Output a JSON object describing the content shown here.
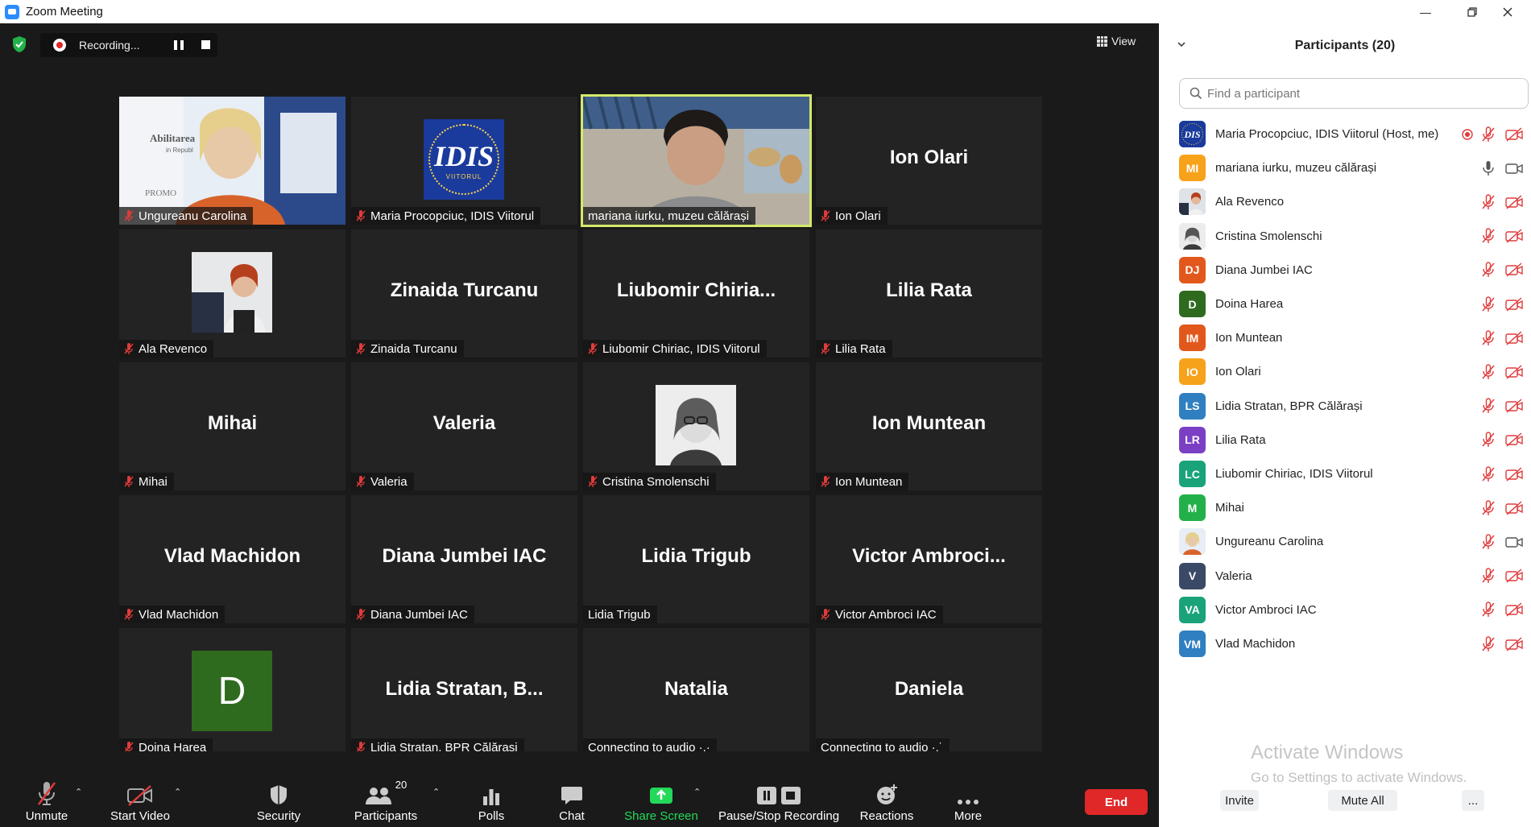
{
  "window": {
    "title": "Zoom Meeting",
    "icon": "zoom-camera-icon"
  },
  "meeting": {
    "recording_label": "Recording...",
    "view_label": "View"
  },
  "tiles": [
    {
      "display": "photo",
      "label": "Ungureanu Carolina",
      "muted": true,
      "photo_text_1": "Abilitarea",
      "photo_text_2": "in Republ",
      "photo_text_3": "PROMO"
    },
    {
      "display": "logo",
      "label": "Maria Procopciuc, IDIS Viitorul",
      "muted": true,
      "logo_text": "IDIS",
      "logo_sub": "VIITORUL"
    },
    {
      "display": "photo",
      "label": "mariana iurku, muzeu călărași",
      "muted": false,
      "active": true
    },
    {
      "display": "name",
      "big": "Ion Olari",
      "label": "Ion Olari",
      "muted": true
    },
    {
      "display": "photo-small",
      "label": "Ala Revenco",
      "muted": true
    },
    {
      "display": "name",
      "big": "Zinaida Turcanu",
      "label": "Zinaida Turcanu",
      "muted": true
    },
    {
      "display": "name",
      "big": "Liubomir  Chiria...",
      "label": "Liubomir Chiriac, IDIS Viitorul",
      "muted": true
    },
    {
      "display": "name",
      "big": "Lilia Rata",
      "label": "Lilia Rata",
      "muted": true
    },
    {
      "display": "name",
      "big": "Mihai",
      "label": "Mihai",
      "muted": true
    },
    {
      "display": "name",
      "big": "Valeria",
      "label": "Valeria",
      "muted": true
    },
    {
      "display": "photo-small-gray",
      "label": "Cristina Smolenschi",
      "muted": true
    },
    {
      "display": "name",
      "big": "Ion Muntean",
      "label": "Ion Muntean",
      "muted": true
    },
    {
      "display": "name",
      "big": "Vlad Machidon",
      "label": "Vlad Machidon",
      "muted": true
    },
    {
      "display": "name",
      "big": "Diana Jumbei IAC",
      "label": "Diana Jumbei IAC",
      "muted": true
    },
    {
      "display": "name",
      "big": "Lidia Trigub",
      "label": "Lidia Trigub",
      "muted": false
    },
    {
      "display": "name",
      "big": "Victor  Ambroci...",
      "label": "Victor Ambroci IAC",
      "muted": true
    },
    {
      "display": "letter",
      "letter": "D",
      "label": "Doina Harea",
      "muted": true
    },
    {
      "display": "name",
      "big": "Lidia  Stratan,  B...",
      "label": "Lidia Stratan, BPR Călărași",
      "muted": true
    },
    {
      "display": "name",
      "big": "Natalia",
      "label": "Connecting to audio ·.·",
      "muted": false
    },
    {
      "display": "name",
      "big": "Daniela",
      "label": "Connecting to audio ·.˙",
      "muted": false
    }
  ],
  "toolbar": {
    "unmute": "Unmute",
    "start_video": "Start Video",
    "security": "Security",
    "participants": "Participants",
    "participants_count": "20",
    "polls": "Polls",
    "chat": "Chat",
    "share_screen": "Share Screen",
    "pause_stop_recording": "Pause/Stop Recording",
    "reactions": "Reactions",
    "more": "More",
    "end": "End",
    "share_color": "#23d959",
    "end_color": "#e02828"
  },
  "panel": {
    "title": "Participants (20)",
    "search_placeholder": "Find a participant",
    "participants": [
      {
        "name": "Maria Procopciuc, IDIS Viitorul (Host, me)",
        "initials": "",
        "avatar": "logo",
        "color": "#1a3a9c",
        "recording": true,
        "mic": "muted",
        "cam": "off"
      },
      {
        "name": "mariana iurku, muzeu călărași",
        "initials": "MI",
        "avatar": "initials",
        "color": "#f7a21b",
        "recording": false,
        "mic": "on",
        "cam": "on"
      },
      {
        "name": "Ala Revenco",
        "initials": "",
        "avatar": "photo",
        "color": "#5a6b7a",
        "recording": false,
        "mic": "muted",
        "cam": "off"
      },
      {
        "name": "Cristina Smolenschi",
        "initials": "",
        "avatar": "photo-gray",
        "color": "#9a9a9a",
        "recording": false,
        "mic": "muted",
        "cam": "off"
      },
      {
        "name": "Diana Jumbei IAC",
        "initials": "DJ",
        "avatar": "initials",
        "color": "#e2581c",
        "recording": false,
        "mic": "muted",
        "cam": "off"
      },
      {
        "name": "Doina Harea",
        "initials": "D",
        "avatar": "initials",
        "color": "#2e6b1f",
        "recording": false,
        "mic": "muted",
        "cam": "off"
      },
      {
        "name": "Ion Muntean",
        "initials": "IM",
        "avatar": "initials",
        "color": "#e2581c",
        "recording": false,
        "mic": "muted",
        "cam": "off"
      },
      {
        "name": "Ion Olari",
        "initials": "IO",
        "avatar": "initials",
        "color": "#f7a21b",
        "recording": false,
        "mic": "muted",
        "cam": "off"
      },
      {
        "name": "Lidia Stratan, BPR Călărași",
        "initials": "LS",
        "avatar": "initials",
        "color": "#2f7fc1",
        "recording": false,
        "mic": "muted",
        "cam": "off"
      },
      {
        "name": "Lilia Rata",
        "initials": "LR",
        "avatar": "initials",
        "color": "#7b3fc4",
        "recording": false,
        "mic": "muted",
        "cam": "off"
      },
      {
        "name": "Liubomir Chiriac, IDIS Viitorul",
        "initials": "LC",
        "avatar": "initials",
        "color": "#1aa37a",
        "recording": false,
        "mic": "muted",
        "cam": "off"
      },
      {
        "name": "Mihai",
        "initials": "M",
        "avatar": "initials",
        "color": "#23b04a",
        "recording": false,
        "mic": "muted",
        "cam": "off"
      },
      {
        "name": "Ungureanu Carolina",
        "initials": "",
        "avatar": "photo-warm",
        "color": "#c9a37a",
        "recording": false,
        "mic": "muted",
        "cam": "on"
      },
      {
        "name": "Valeria",
        "initials": "V",
        "avatar": "initials",
        "color": "#3a4a66",
        "recording": false,
        "mic": "muted",
        "cam": "off"
      },
      {
        "name": "Victor Ambroci IAC",
        "initials": "VA",
        "avatar": "initials",
        "color": "#1aa37a",
        "recording": false,
        "mic": "muted",
        "cam": "off"
      },
      {
        "name": "Vlad Machidon",
        "initials": "VM",
        "avatar": "initials",
        "color": "#2f7fc1",
        "recording": false,
        "mic": "muted",
        "cam": "off"
      }
    ],
    "watermark_title": "Activate Windows",
    "watermark_sub": "Go to Settings to activate Windows.",
    "invite": "Invite",
    "mute_all": "Mute All",
    "more": "..."
  }
}
